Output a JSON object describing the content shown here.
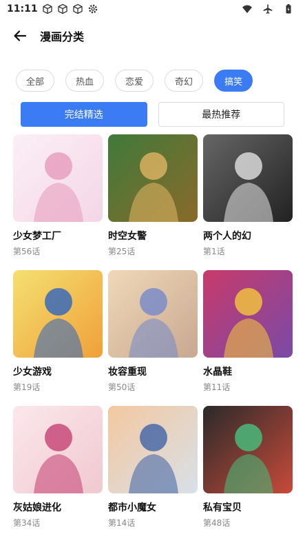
{
  "status": {
    "time": "11:11"
  },
  "header": {
    "title": "漫画分类"
  },
  "categories": [
    "全部",
    "热血",
    "恋爱",
    "奇幻",
    "搞笑"
  ],
  "active_category": "搞笑",
  "tabs": [
    "完结精选",
    "最热推荐"
  ],
  "active_tab": "完结精选",
  "comics": [
    {
      "title": "少女梦工厂",
      "chapters": "第56话",
      "cover_colors": [
        "#f4d6e6",
        "#e8a0c0",
        "#fbeff6"
      ]
    },
    {
      "title": "时空女警",
      "chapters": "第25话",
      "cover_colors": [
        "#8a6a2a",
        "#d8b060",
        "#3f7a3a"
      ]
    },
    {
      "title": "两个人的幻",
      "chapters": "第1话",
      "cover_colors": [
        "#222222",
        "#d8d8d8",
        "#666666"
      ]
    },
    {
      "title": "少女游戏",
      "chapters": "第19话",
      "cover_colors": [
        "#f0a03a",
        "#3a6ab8",
        "#f4e070"
      ]
    },
    {
      "title": "妆容重现",
      "chapters": "第50话",
      "cover_colors": [
        "#c8a890",
        "#7a8cc8",
        "#f0d8b8"
      ]
    },
    {
      "title": "水晶鞋",
      "chapters": "第11话",
      "cover_colors": [
        "#7a4aa8",
        "#f0c040",
        "#c83a6a"
      ]
    },
    {
      "title": "灰姑娘进化",
      "chapters": "第34话",
      "cover_colors": [
        "#f0c8d0",
        "#c84a7a",
        "#fbe8ec"
      ]
    },
    {
      "title": "都市小魔女",
      "chapters": "第14话",
      "cover_colors": [
        "#d8e0e8",
        "#4a6aa8",
        "#f4c8a0"
      ]
    },
    {
      "title": "私有宝贝",
      "chapters": "第48话",
      "cover_colors": [
        "#c84a3a",
        "#4ab87a",
        "#2a2a2a"
      ]
    }
  ],
  "colors": {
    "accent": "#3b7cf4",
    "text": "#111111",
    "muted": "#888888"
  }
}
